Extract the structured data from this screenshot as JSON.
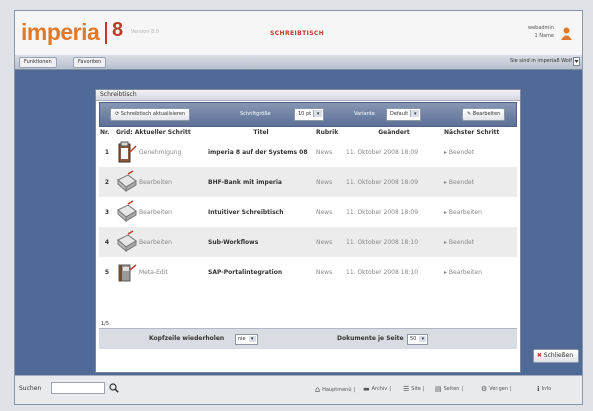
{
  "header": {
    "logo": "imperia",
    "version": "8",
    "version_sub": "Version 8.0",
    "center_title": "SCHREIBTISCH",
    "user_name": "webadmin",
    "user_role": "1 Name"
  },
  "nav": {
    "left_button": "Funktionen",
    "second_button": "Favoriten",
    "right_info": "Sie sind in imperia8 Wolf"
  },
  "panel": {
    "title": "Schreibtisch",
    "toolbar": {
      "refresh_button": "Schreibtisch aktualisieren",
      "font_size_label": "Schriftgröße",
      "font_size_value": "10 pt",
      "variant_label": "Variante",
      "variant_value": "Default",
      "edit_button": "Bearbeiten"
    },
    "columns": [
      "Nr.",
      "Grid: Aktueller Schritt",
      "Titel",
      "Rubrik",
      "Geändert",
      "Nächster Schritt"
    ],
    "rows": [
      {
        "nr": "1",
        "step": "Genehmigung",
        "icon": "document-approval-icon",
        "title": "imperia 8 auf der Systems 08",
        "rubrik": "News",
        "changed": "11. Oktober 2008 18:09",
        "next": "Beendet"
      },
      {
        "nr": "2",
        "step": "Bearbeiten",
        "icon": "edit-document-icon",
        "title": "BHF-Bank mit imperia",
        "rubrik": "News",
        "changed": "11. Oktober 2008 18:09",
        "next": "Beendet"
      },
      {
        "nr": "3",
        "step": "Bearbeiten",
        "icon": "edit-document-icon",
        "title": "Intuitiver Schreibtisch",
        "rubrik": "News",
        "changed": "11. Oktober 2008 18:09",
        "next": "Bearbeiten"
      },
      {
        "nr": "4",
        "step": "Bearbeiten",
        "icon": "edit-document-icon",
        "title": "Sub-Workflows",
        "rubrik": "News",
        "changed": "11. Oktober 2008 18:10",
        "next": "Beendet"
      },
      {
        "nr": "5",
        "step": "Meta-Edit",
        "icon": "meta-edit-icon",
        "title": "SAP-Portalintegration",
        "rubrik": "News",
        "changed": "11. Oktober 2008 18:10",
        "next": "Bearbeiten"
      }
    ],
    "count": "1/5",
    "footer": {
      "repeat_header_label": "Kopfzeile wiederholen",
      "repeat_header_value": "nie",
      "docs_per_page_label": "Dokumente je Seite",
      "docs_per_page_value": "50"
    }
  },
  "close_button": "Schließen",
  "status": {
    "search_label": "Suchen",
    "search_value": "",
    "links": [
      "Hauptmenü",
      "Archiv",
      "Site",
      "Seiten",
      "Ver.gen",
      "Info"
    ]
  },
  "colors": {
    "background_blue": "#4f6a97",
    "accent_orange": "#e07a2a",
    "accent_red": "#c0392b"
  }
}
